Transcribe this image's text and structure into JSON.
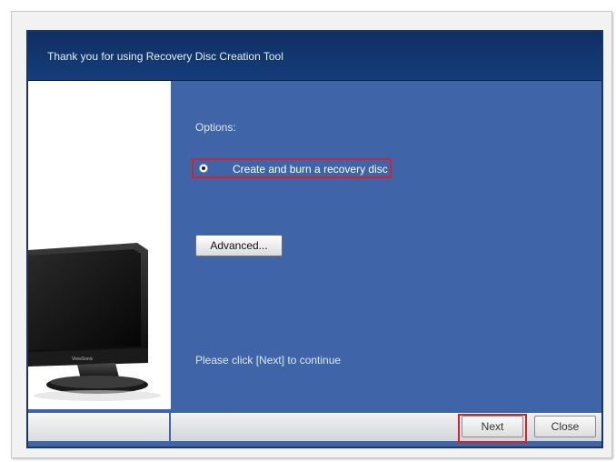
{
  "window": {
    "title": "Thank you for using Recovery Disc Creation Tool"
  },
  "illustration": {
    "icon": "monitor-icon",
    "brand_text": "ViewSonic"
  },
  "content": {
    "options_label": "Options:",
    "radio_option": {
      "label": "Create and burn a recovery disc",
      "selected": true
    },
    "advanced_button_label": "Advanced...",
    "instruction_text": "Please click [Next] to continue"
  },
  "footer": {
    "next_label": "Next",
    "close_label": "Close"
  },
  "colors": {
    "window_bg": "#3f65a8",
    "title_bar_bg": "#0f2f63",
    "highlight_border": "#d3222a"
  }
}
